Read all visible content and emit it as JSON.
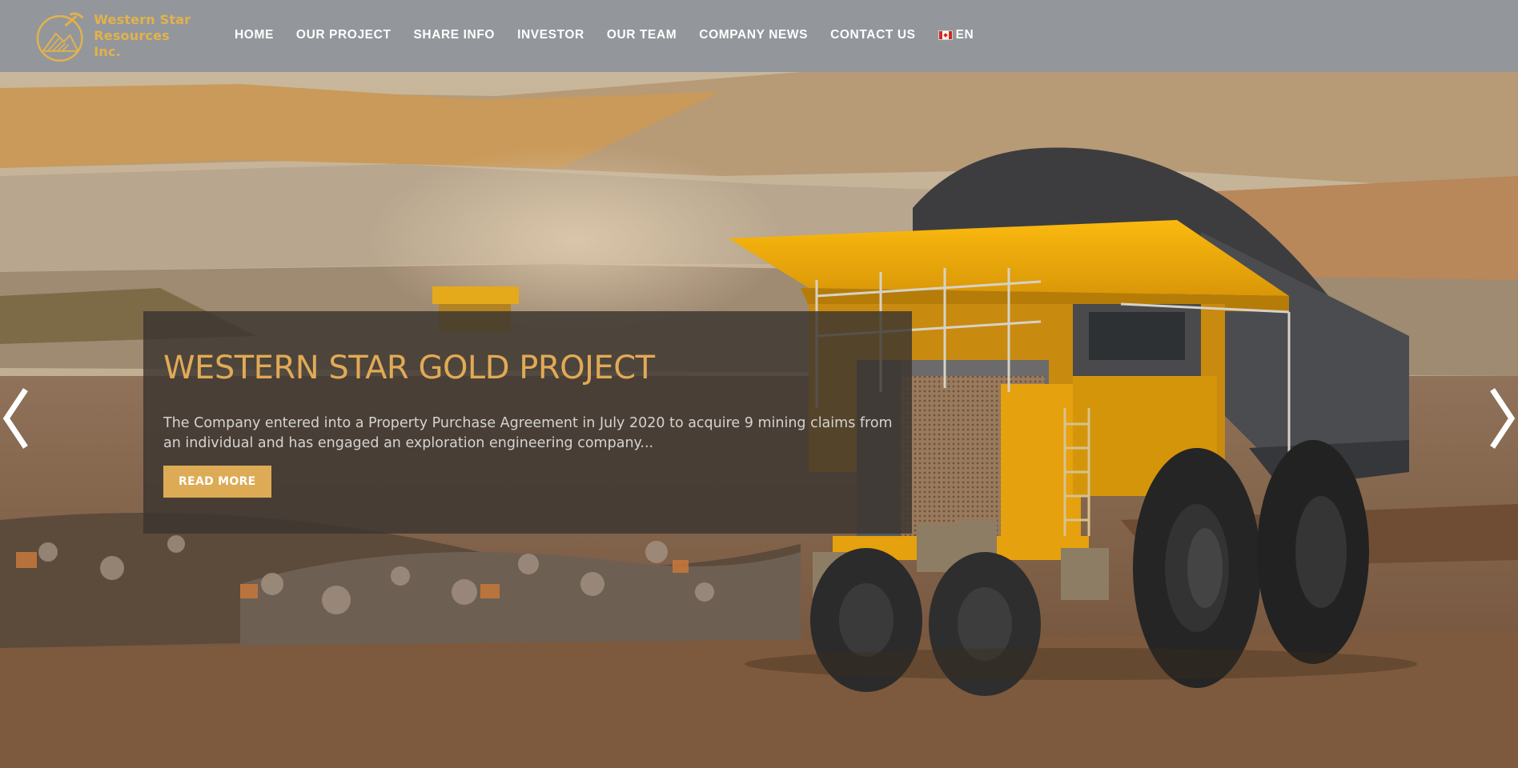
{
  "header": {
    "logo_line1": "Western Star",
    "logo_line2": "Resources Inc.",
    "nav": [
      "HOME",
      "OUR PROJECT",
      "SHARE INFO",
      "INVESTOR",
      "OUR TEAM",
      "COMPANY NEWS",
      "CONTACT US"
    ],
    "language": "EN",
    "language_flag_icon": "canada-flag-icon"
  },
  "slider": {
    "title": "WESTERN STAR GOLD PROJECT",
    "text": "The Company entered into a Property Purchase Agreement in July 2020 to acquire 9 mining claims from an individual and has engaged an exploration engineering company...",
    "button_label": "READ MORE",
    "prev_icon": "chevron-left-icon",
    "next_icon": "chevron-right-icon"
  },
  "colors": {
    "header_bg": "#93979c",
    "accent_gold": "#e1aa55",
    "caption_bg": "#3a3430"
  }
}
